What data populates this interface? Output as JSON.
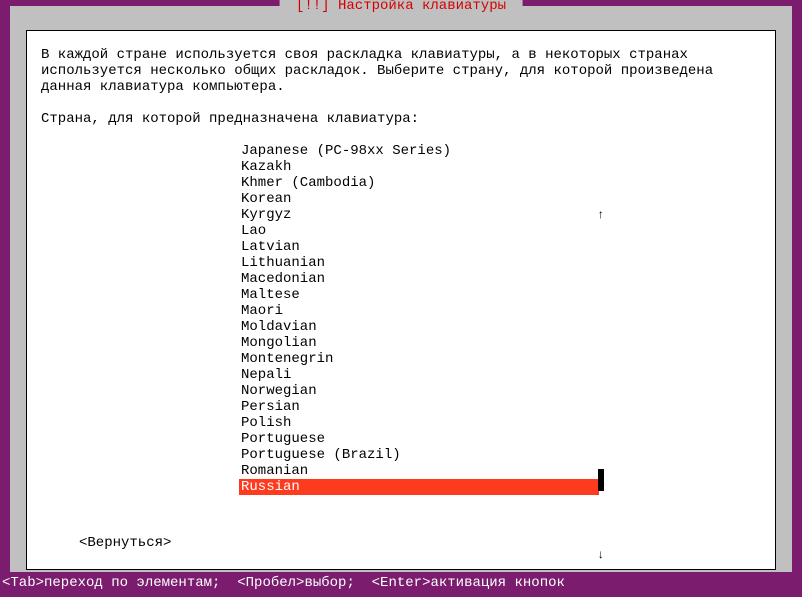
{
  "title": " [!!] Настройка клавиатуры ",
  "description": "В каждой стране используется своя раскладка клавиатуры, а в некоторых странах используется несколько общих раскладок. Выберите страну, для которой произведена данная клавиатура компьютера.",
  "prompt": "Страна, для которой предназначена клавиатура:",
  "items": [
    "Japanese (PC-98xx Series)",
    "Kazakh",
    "Khmer (Cambodia)",
    "Korean",
    "Kyrgyz",
    "Lao",
    "Latvian",
    "Lithuanian",
    "Macedonian",
    "Maltese",
    "Maori",
    "Moldavian",
    "Mongolian",
    "Montenegrin",
    "Nepali",
    "Norwegian",
    "Persian",
    "Polish",
    "Portuguese",
    "Portuguese (Brazil)",
    "Romanian",
    "Russian"
  ],
  "selected_index": 21,
  "back_label": "<Вернуться>",
  "footer": "<Tab>переход по элементам;  <Пробел>выбор;  <Enter>активация кнопок",
  "icons": {
    "up": "↑",
    "down": "↓"
  }
}
